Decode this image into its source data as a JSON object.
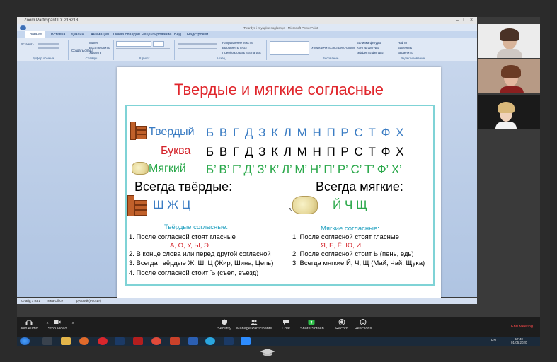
{
  "window": {
    "title": "Zoom Participant ID: 216213",
    "doc_title": "Twardye i myagkie soglasnye - Microsoft PowerPoint"
  },
  "ribbon": {
    "tabs": [
      "Главная",
      "Вставка",
      "Дизайн",
      "Анимация",
      "Показ слайдов",
      "Рецензирование",
      "Вид",
      "Надстройки"
    ],
    "groups": [
      "Буфер обмена",
      "Слайды",
      "Шрифт",
      "Абзац",
      "Рисование",
      "Редактирование"
    ],
    "buttons": [
      "Вставить",
      "Создать слайд",
      "Макет",
      "Восстановить",
      "Удалить",
      "Направление текста",
      "Выровнять текст",
      "Преобразовать в SmartArt",
      "Упорядочить",
      "Экспресс-стили",
      "Заливка фигуры",
      "Контур фигуры",
      "Эффекты фигуры",
      "Найти",
      "Заменить",
      "Выделить"
    ]
  },
  "slide": {
    "title": "Твердые и мягкие согласные",
    "row_hard": {
      "label": "Твердый",
      "letters": "Б В Г Д З К Л М Н П Р С Т Ф Х"
    },
    "row_letter": {
      "label": "Буква",
      "letters": "Б В Г Д З К Л М Н П Р С Т Ф Х"
    },
    "row_soft": {
      "label": "Мягкий",
      "letters": "Б’ В’ Г’ Д’ З’ К’ Л’ М’ Н’ П’ Р’ С’ Т’ Ф’ Х’"
    },
    "always_hard": {
      "heading": "Всегда твёрдые:",
      "letters": "Ш  Ж  Ц"
    },
    "always_soft": {
      "heading": "Всегда мягкие:",
      "letters": "Й  Ч  Щ"
    },
    "hard_notes": {
      "title": "Твёрдые согласные:",
      "items": [
        "1. После согласной стоят гласные",
        "А, О, У, Ы, Э",
        "2. В конце слова или перед другой согласной",
        "3. Всегда твёрдые Ж, Ш, Ц (Жир, Шина, Цепь)",
        "4. После согласной стоит Ъ (съел, въезд)"
      ]
    },
    "soft_notes": {
      "title": "Мягкие согласные:",
      "items": [
        "1. После согласной стоят гласные",
        "Я, Е, Ё, Ю, И",
        "2. После согласной стоит Ь (пень, едь)",
        "3. Всегда мягкие Й, Ч, Щ (Май, Чай, Щука)"
      ]
    }
  },
  "statusbar": {
    "slide": "Слайд 1 из 1",
    "theme": "\"Тема Office\"",
    "lang": "русский (Россия)"
  },
  "zoom": {
    "controls": [
      "Join Audio",
      "Stop Video",
      "Security",
      "Manage Participants",
      "Chat",
      "Share Screen",
      "Record",
      "Reactions"
    ],
    "end": "End Meeting"
  },
  "taskbar": {
    "lang": "EN",
    "time": "17:40",
    "date": "01.05.2020"
  }
}
